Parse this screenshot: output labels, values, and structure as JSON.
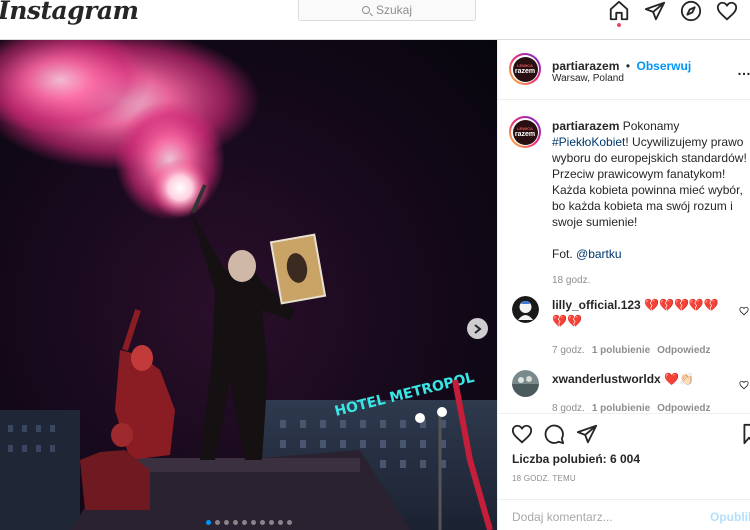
{
  "topbar": {
    "logo": "Instagram",
    "search_placeholder": "Szukaj",
    "icons": [
      "home-icon",
      "direct-icon",
      "explore-icon",
      "activity-icon"
    ]
  },
  "photo": {
    "neon_sign": "HOTEL METROPOL",
    "carousel_total": 10,
    "carousel_active": 1
  },
  "post": {
    "username": "partiarazem",
    "separator": "•",
    "follow_label": "Obserwuj",
    "location": "Warsaw, Poland",
    "avatar_text_top": "LEWICA",
    "avatar_text_main": "razem",
    "more_label": "…",
    "caption": {
      "username": "partiarazem",
      "text_before": "Pokonamy ",
      "hashtag": "#PiekłoKobiet",
      "text_after": "! Ucywilizujemy prawo wyboru do europejskich standardów! Przeciw prawicowym fanatykom! Każda kobieta powinna mieć wybór, bo każda kobieta ma swój rozum i swoje sumienie!",
      "credit_prefix": "Fot. ",
      "credit_mention": "@bartku",
      "time": "18 godz."
    },
    "comments": [
      {
        "username": "lilly_official.123",
        "text": "💔💔💔💔💔 💔💔",
        "time": "7 godz.",
        "likes": "1 polubienie",
        "reply": "Odpowiedz"
      },
      {
        "username": "xwanderlustworldx",
        "text": "❤️👏🏻",
        "time": "8 godz.",
        "likes": "1 polubienie",
        "reply": "Odpowiedz"
      }
    ],
    "likes_label": "Liczba polubień: 6 004",
    "time_ago": "18 GODZ. TEMU",
    "add_comment_placeholder": "Dodaj komentarz...",
    "publish_label": "Opublikuj"
  },
  "colors": {
    "accent": "#0095f6",
    "link": "#00376b",
    "muted": "#8e8e8e",
    "flare": "#ff2a6d",
    "neon": "#39e6e6"
  }
}
